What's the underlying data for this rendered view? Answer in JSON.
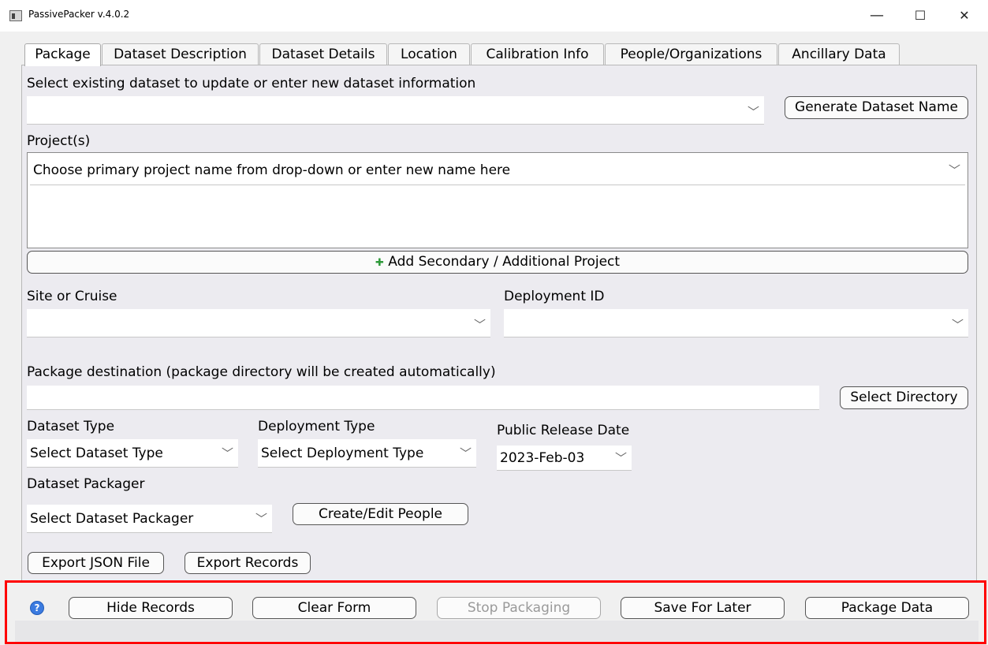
{
  "window": {
    "title": "PassivePacker v.4.0.2",
    "minimize": "—",
    "maximize": "☐",
    "close": "✕"
  },
  "tabs": [
    "Package",
    "Dataset Description",
    "Dataset Details",
    "Location",
    "Calibration Info",
    "People/Organizations",
    "Ancillary Data"
  ],
  "form": {
    "dataset_select_label": "Select existing dataset to update or enter new dataset information",
    "dataset_select_value": "",
    "generate_name_button": "Generate Dataset Name",
    "projects_label": "Project(s)",
    "project_placeholder": "Choose primary project name from drop-down or enter new name here",
    "add_project_button": "Add Secondary / Additional Project",
    "site_label": "Site or Cruise",
    "site_value": "",
    "deployment_id_label": "Deployment ID",
    "deployment_id_value": "",
    "destination_label": "Package destination (package directory will be created automatically)",
    "destination_value": "",
    "select_directory_button": "Select Directory",
    "dataset_type_label": "Dataset Type",
    "dataset_type_value": "Select Dataset Type",
    "deployment_type_label": "Deployment Type",
    "deployment_type_value": "Select Deployment Type",
    "release_date_label": "Public Release Date",
    "release_date_value": "2023-Feb-03",
    "packager_label": "Dataset Packager",
    "packager_value": "Select Dataset Packager",
    "create_people_button": "Create/Edit People",
    "export_json_button": "Export JSON File",
    "export_records_button": "Export Records"
  },
  "footer": {
    "help_icon": "?",
    "hide_records": "Hide Records",
    "clear_form": "Clear Form",
    "stop_packaging": "Stop Packaging",
    "save_for_later": "Save For Later",
    "package_data": "Package Data"
  },
  "icons": {
    "chevron": "﹀",
    "plus": "✚"
  },
  "colors": {
    "highlight_box": "#ff0000",
    "plus_icon": "#2e9a3a",
    "help_icon": "#3b7be0"
  }
}
